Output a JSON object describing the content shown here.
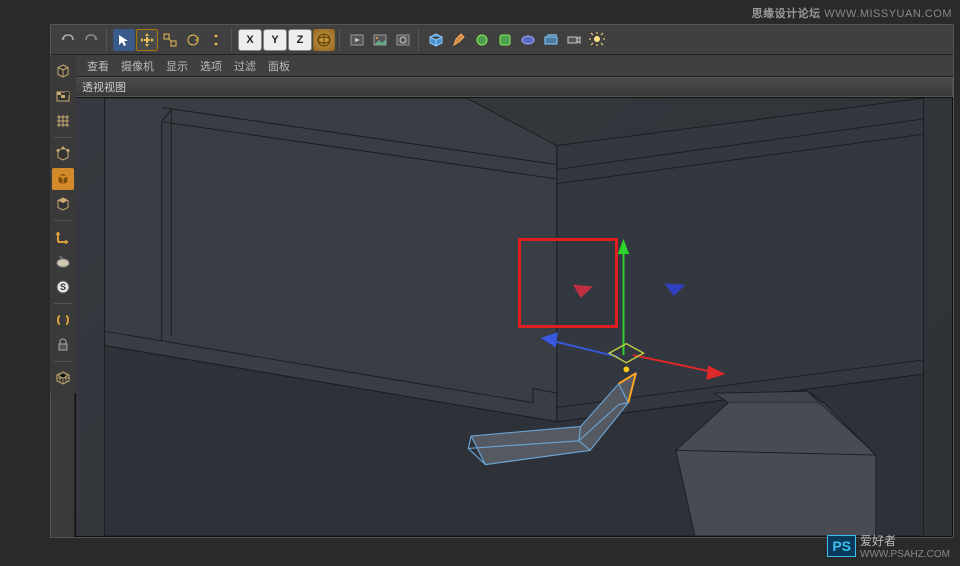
{
  "watermark_top": {
    "brand": "思缘设计论坛",
    "url": "WWW.MISSYUAN.COM"
  },
  "watermark_bottom": {
    "tag": "PS",
    "brand": "爱好者",
    "url": "WWW.PSAHZ.COM"
  },
  "toolbar": {
    "axes": [
      "X",
      "Y",
      "Z"
    ]
  },
  "menubar": {
    "items": [
      "查看",
      "摄像机",
      "显示",
      "选项",
      "过滤",
      "面板"
    ]
  },
  "viewport": {
    "title": "透视视图"
  }
}
